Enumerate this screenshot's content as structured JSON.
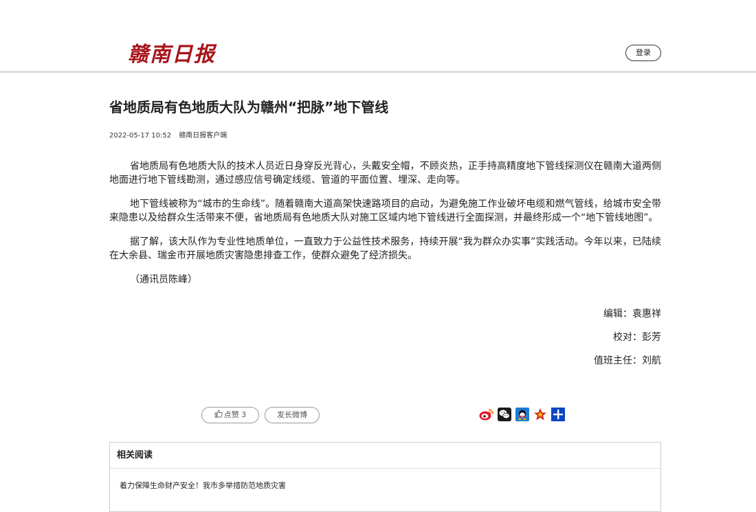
{
  "header": {
    "logo_text": "赣南日报",
    "login_label": "登录"
  },
  "article": {
    "title": "省地质局有色地质大队为赣州“把脉”地下管线",
    "date": "2022-05-17 10:52",
    "source": "赣南日报客户端",
    "paragraphs": [
      "省地质局有色地质大队的技术人员近日身穿反光背心，头戴安全帽，不顾炎热，正手持高精度地下管线探测仪在赣南大道两侧地面进行地下管线勘测，通过感应信号确定线缆、管道的平面位置、埋深、走向等。",
      "地下管线被称为“城市的生命线”。随着赣南大道高架快速路项目的启动，为避免施工作业破坏电缆和燃气管线，给城市安全带来隐患以及给群众生活带来不便，省地质局有色地质大队对施工区域内地下管线进行全面探测，并最终形成一个“地下管线地图”。",
      "据了解，该大队作为专业性地质单位，一直致力于公益性技术服务，持续开展“我为群众办实事”实践活动。今年以来，已陆续在大余县、瑞金市开展地质灾害隐患排查工作，使群众避免了经济损失。",
      "（通讯员陈峰）"
    ],
    "editor": "编辑：袁惠祥",
    "proofreader": "校对：彭芳",
    "duty_chief": "值班主任：刘航"
  },
  "actions": {
    "like_label": "点赞 3",
    "weibo_label": "发长微博"
  },
  "share": {
    "icons": [
      "weibo-icon",
      "wechat-icon",
      "qq-icon",
      "qzone-icon",
      "more-share-icon"
    ],
    "colors": {
      "weibo": "#e6162d",
      "wechat": "#1a1a1a",
      "qq": "#1f7bd3",
      "qzone": "#d9261c",
      "more": "#0b46c4"
    }
  },
  "related": {
    "header": "相关阅读",
    "items": [
      "着力保障生命财产安全！我市多举措防范地质灾害"
    ]
  }
}
